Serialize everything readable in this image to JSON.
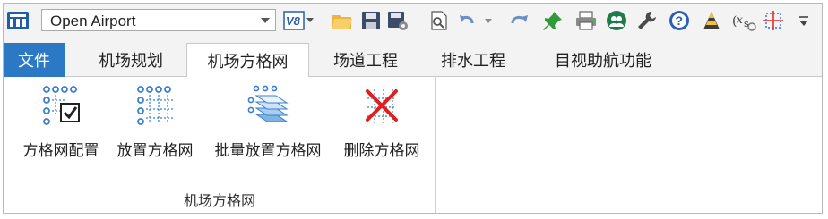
{
  "quick_access": {
    "workflow_value": "Open Airport",
    "version_badge": "V8",
    "icons": [
      "app-menu-icon",
      "version-icon",
      "open-folder-icon",
      "save-icon",
      "save-settings-icon",
      "print-preview-icon",
      "undo-icon",
      "redo-icon",
      "pin-icon",
      "print-icon",
      "user-icon",
      "wrench-icon",
      "help-icon",
      "cone-icon",
      "function-icon",
      "crosshair-icon",
      "customize-icon"
    ]
  },
  "tabs": [
    {
      "label": "文件"
    },
    {
      "label": "机场规划"
    },
    {
      "label": "机场方格网"
    },
    {
      "label": "场道工程"
    },
    {
      "label": "排水工程"
    },
    {
      "label": "目视助航功能"
    }
  ],
  "ribbon": {
    "group_label": "机场方格网",
    "buttons": [
      {
        "label": "方格网配置",
        "icon": "grid-config-icon"
      },
      {
        "label": "放置方格网",
        "icon": "grid-place-icon"
      },
      {
        "label": "批量放置方格网",
        "icon": "grid-batch-icon"
      },
      {
        "label": "删除方格网",
        "icon": "grid-delete-icon"
      }
    ]
  },
  "colors": {
    "file_tab": "#2b78c5",
    "accent_blue": "#3a7fd0",
    "delete_red": "#e02020"
  }
}
